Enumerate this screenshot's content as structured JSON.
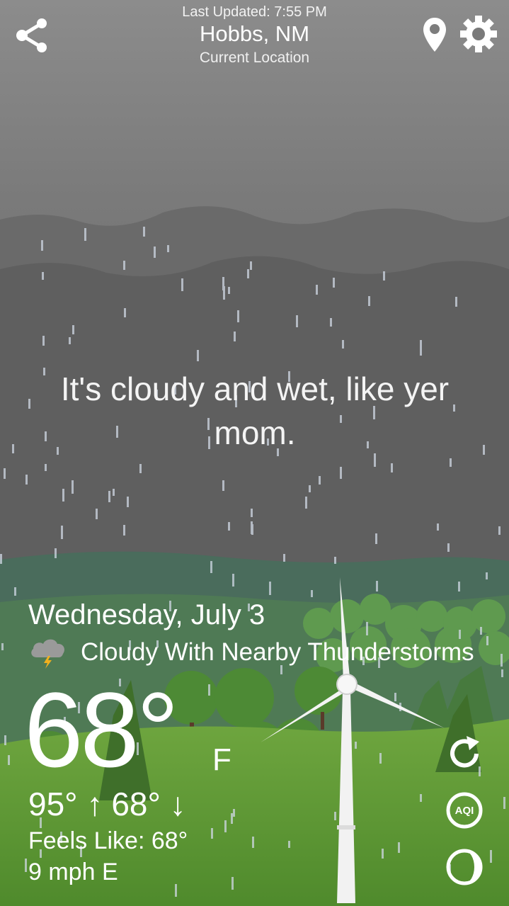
{
  "header": {
    "last_updated": "Last Updated: 7:55 PM",
    "city": "Hobbs, NM",
    "subtitle": "Current Location"
  },
  "quip": "It's cloudy and wet, like yer mom.",
  "forecast": {
    "date": "Wednesday, July 3",
    "condition": "Cloudy With Nearby Thunderstorms",
    "condition_icon": "thunderstorm-cloud-icon",
    "temperature": "68°",
    "unit": "F",
    "high": "95° ↑",
    "low": "68° ↓",
    "feels_like": "Feels Like: 68°",
    "wind": "9 mph E"
  },
  "icons": {
    "share": "share-icon",
    "location": "location-pin-icon",
    "settings": "gear-icon",
    "refresh": "refresh-icon",
    "aqi": "aqi-icon",
    "moon": "moon-phase-icon"
  },
  "aqi_label": "AQI",
  "colors": {
    "sky_top": "#8a8a8a",
    "cloud_band": "#5f5f5f",
    "hills": "#4d7a5c",
    "meadow": "#6aa23c"
  }
}
